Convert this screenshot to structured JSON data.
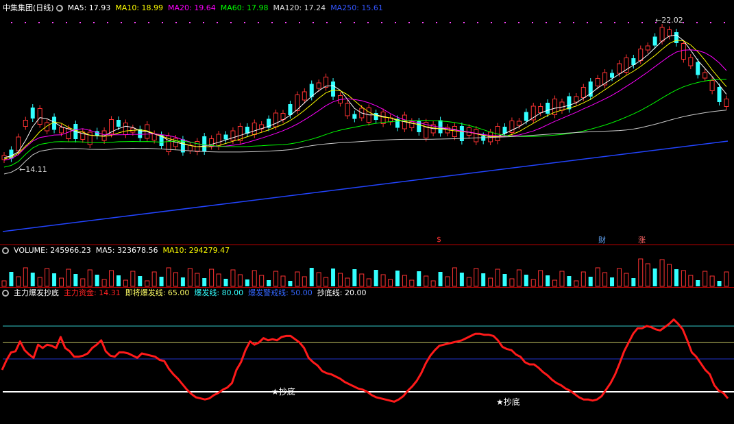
{
  "price_panel": {
    "stock_name": "中集集团(日线)",
    "ma_items": [
      {
        "label": "MA5: 17.93",
        "color": "#ffffff"
      },
      {
        "label": "MA10: 18.99",
        "color": "#ffff00"
      },
      {
        "label": "MA20: 19.64",
        "color": "#ff00ff"
      },
      {
        "label": "MA60: 17.98",
        "color": "#00ff00"
      },
      {
        "label": "MA120: 17.24",
        "color": "#dddddd"
      },
      {
        "label": "MA250: 15.61",
        "color": "#3355ff"
      }
    ],
    "high_label": "22.02",
    "low_label": "14.11",
    "markers": [
      {
        "text": "$",
        "color": "#ff3333"
      },
      {
        "text": "财",
        "color": "#66aaff"
      },
      {
        "text": "涨",
        "color": "#ff6666"
      }
    ]
  },
  "volume_panel": {
    "items": [
      {
        "label": "VOLUME: 245966.23",
        "color": "#ffffff"
      },
      {
        "label": "MA5: 323678.56",
        "color": "#ffffff"
      },
      {
        "label": "MA10: 294279.47",
        "color": "#ffff00"
      }
    ]
  },
  "indicator_panel": {
    "title": "主力爆发抄底",
    "items": [
      {
        "label": "主力资金: 14.31",
        "color": "#ff2222"
      },
      {
        "label": "即将爆发线: 65.00",
        "color": "#ffff66"
      },
      {
        "label": "爆发线: 80.00",
        "color": "#33ffff"
      },
      {
        "label": "爆发警戒线: 50.00",
        "color": "#3366ff"
      },
      {
        "label": "抄底线: 20.00",
        "color": "#ffffff"
      }
    ],
    "signal_label": "★抄底"
  },
  "chart_data": {
    "type": "line",
    "series": [
      {
        "name": "主力资金",
        "values": [
          40,
          49,
          56,
          57,
          66,
          58,
          54,
          51,
          63,
          60,
          63,
          62,
          60,
          70,
          60,
          57,
          52,
          52,
          53,
          55,
          60,
          63,
          67,
          57,
          53,
          52,
          56,
          56,
          55,
          53,
          51,
          55,
          54,
          53,
          52,
          49,
          48,
          41,
          36,
          32,
          27,
          22,
          18,
          15,
          14,
          13,
          14,
          17,
          19,
          22,
          24,
          28,
          40,
          47,
          58,
          66,
          63,
          65,
          69,
          67,
          68,
          67,
          70,
          71,
          71,
          68,
          65,
          60,
          51,
          47,
          44,
          39,
          37,
          36,
          34,
          32,
          29,
          27,
          25,
          23,
          22,
          20,
          17,
          15,
          14,
          13,
          12,
          11,
          13,
          16,
          21,
          25,
          30,
          37,
          46,
          53,
          58,
          62,
          63,
          64,
          65,
          66,
          67,
          69,
          71,
          73,
          73,
          72,
          72,
          71,
          67,
          61,
          59,
          58,
          54,
          52,
          47,
          45,
          45,
          42,
          38,
          35,
          31,
          28,
          26,
          23,
          21,
          18,
          15,
          13,
          13,
          12,
          13,
          16,
          22,
          28,
          36,
          46,
          57,
          65,
          73,
          78,
          78,
          80,
          79,
          77,
          76,
          79,
          82,
          86,
          82,
          77,
          67,
          56,
          52,
          46,
          40,
          36,
          26,
          21,
          19,
          14
        ]
      }
    ]
  }
}
